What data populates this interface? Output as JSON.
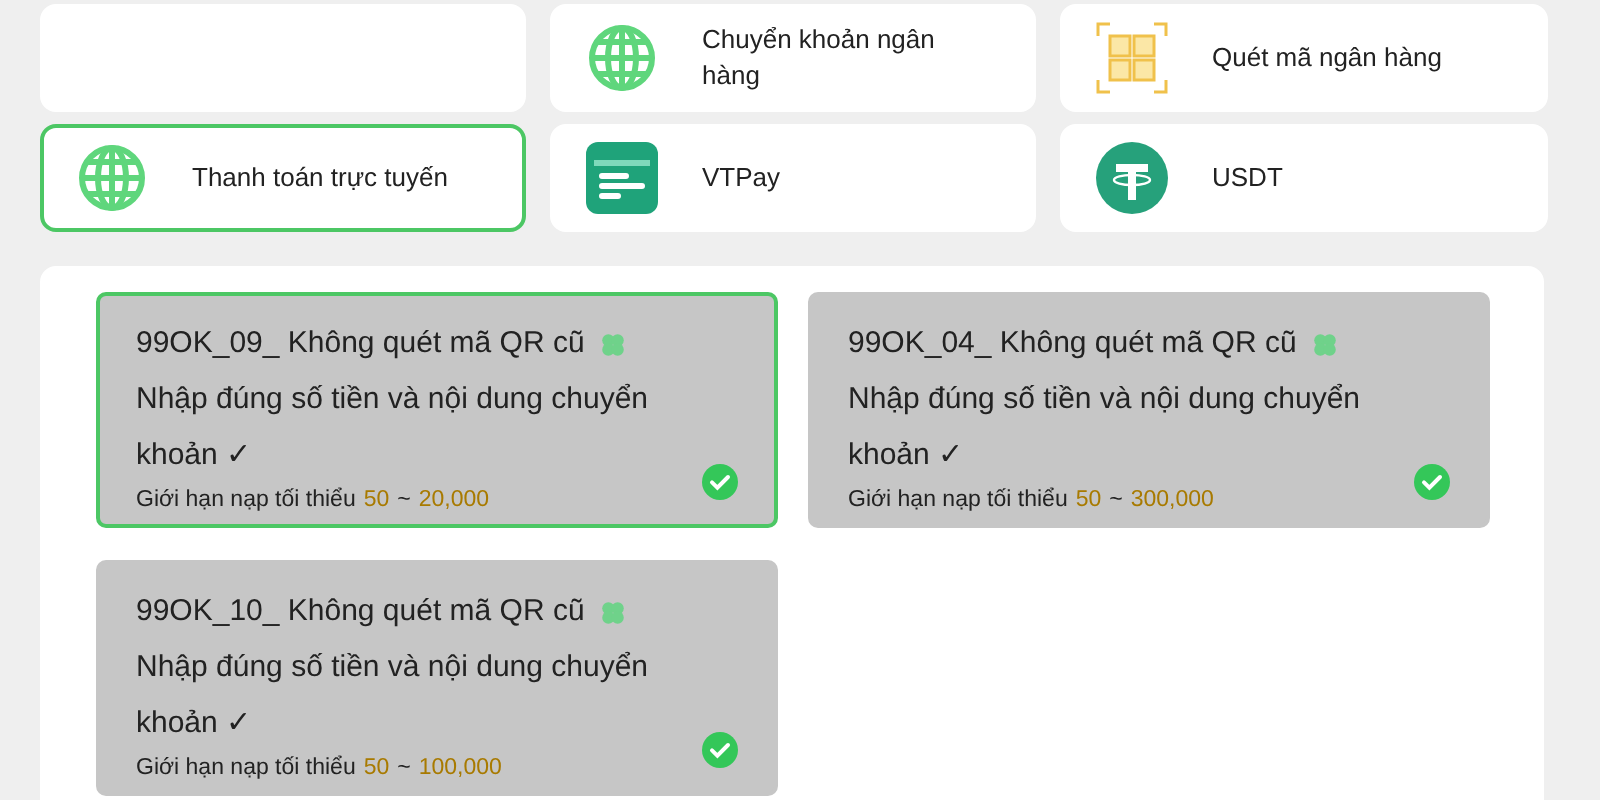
{
  "methods": [
    {
      "label": "Chuyển khoản ngân hàng",
      "kind": "globe",
      "selected": false
    },
    {
      "label": "Quét mã ngân hàng",
      "kind": "qr",
      "selected": false
    },
    {
      "label": "Thanh toán trực tuyến",
      "kind": "globe",
      "selected": true
    },
    {
      "label": "VTPay",
      "kind": "vtpay",
      "selected": false
    },
    {
      "label": "USDT",
      "kind": "tether",
      "selected": false
    }
  ],
  "channels": [
    {
      "title": "99OK_09_ Không quét mã QR cũ",
      "note": "Nhập đúng số tiền và nội dung chuyển khoản ✓",
      "limit_label": "Giới hạn nạp tối thiểu",
      "min": "50",
      "separator": "~",
      "max": "20,000",
      "selected": true
    },
    {
      "title": "99OK_04_ Không quét mã QR cũ",
      "note": "Nhập đúng số tiền và nội dung chuyển khoản ✓",
      "limit_label": "Giới hạn nạp tối thiểu",
      "min": "50",
      "separator": "~",
      "max": "300,000",
      "selected": false
    },
    {
      "title": "99OK_10_ Không quét mã QR cũ",
      "note": "Nhập đúng số tiền và nội dung chuyển khoản ✓",
      "limit_label": "Giới hạn nạp tối thiểu",
      "min": "50",
      "separator": "~",
      "max": "100,000",
      "selected": false
    }
  ]
}
